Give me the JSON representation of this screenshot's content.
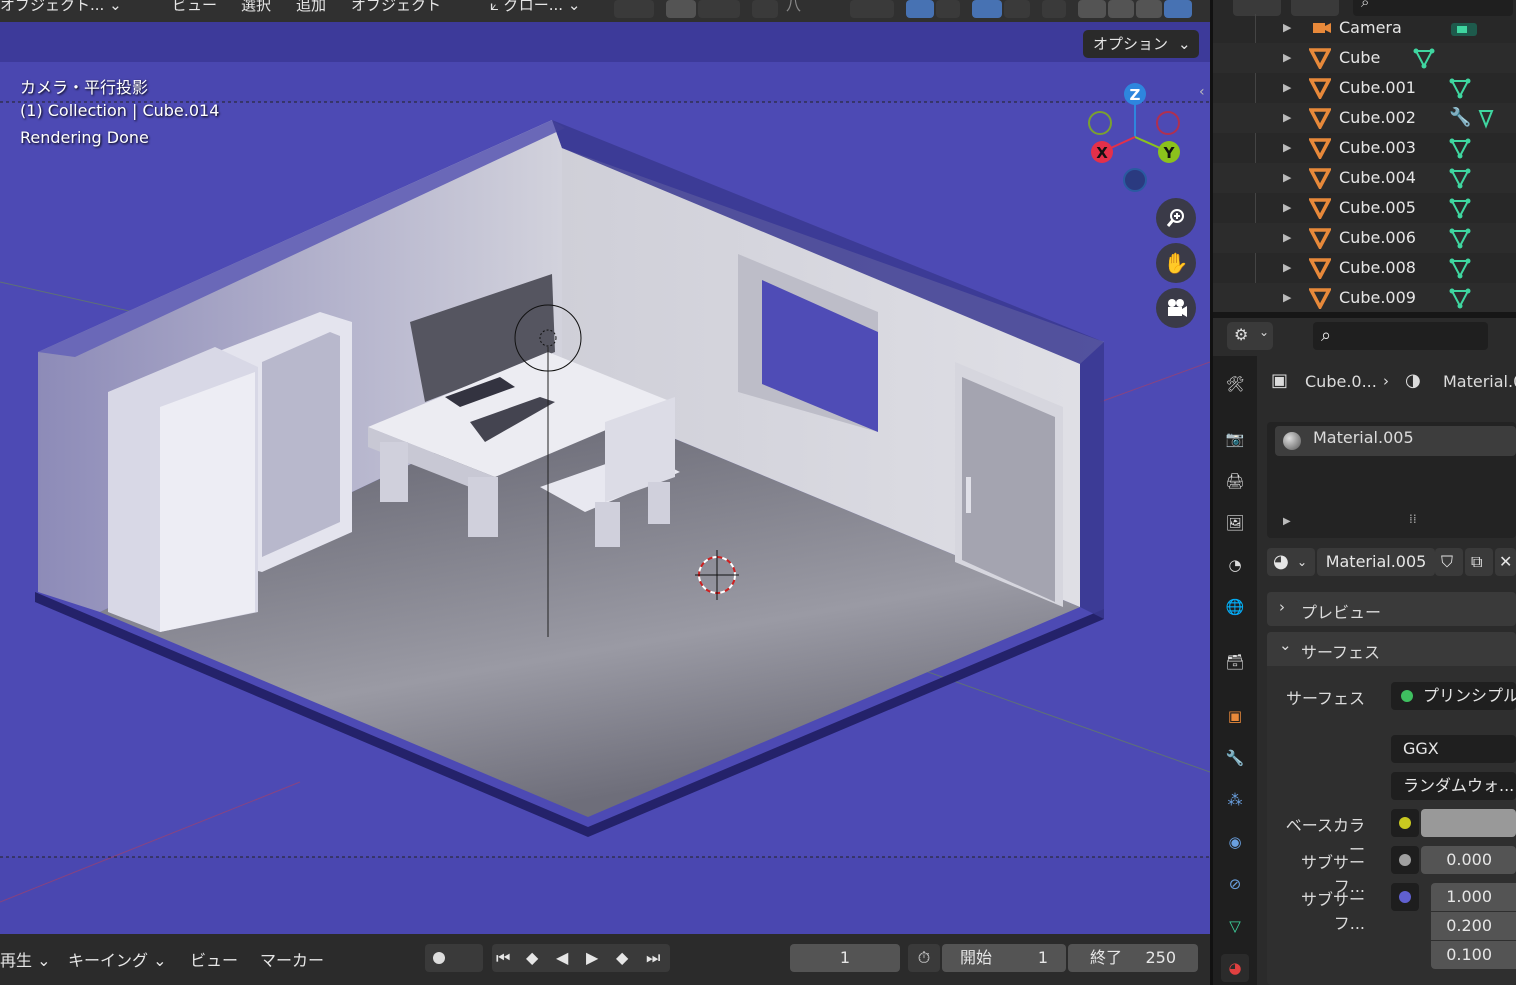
{
  "header": {
    "mode_label": "オブジェクト...",
    "menus": [
      "ビュー",
      "選択",
      "追加",
      "オブジェクト"
    ],
    "transform_orientation": "グロー...",
    "snap_label": "八",
    "options_label": "オプション"
  },
  "viewport": {
    "camera_label": "カメラ・平行投影",
    "collection_label": "(1) Collection | Cube.014",
    "status_label": "Rendering Done",
    "gizmo": {
      "z": "Z",
      "y": "Y",
      "x": "X"
    },
    "background_color": "#4a47b0"
  },
  "timeline": {
    "playback_label": "再生",
    "keying_label": "キーイング",
    "view_label": "ビュー",
    "marker_label": "マーカー",
    "current_frame": "1",
    "start_label": "開始",
    "start_value": "1",
    "end_label": "終了",
    "end_value": "250"
  },
  "outliner": {
    "rows": [
      {
        "name": "Camera",
        "icon": "camera-data-icon"
      },
      {
        "name": "Cube",
        "icon": "mesh-data-icon"
      },
      {
        "name": "Cube.001",
        "icon": "mesh-data-icon"
      },
      {
        "name": "Cube.002",
        "icon": "modifier-wrench-icon"
      },
      {
        "name": "Cube.003",
        "icon": "mesh-data-icon"
      },
      {
        "name": "Cube.004",
        "icon": "mesh-data-icon"
      },
      {
        "name": "Cube.005",
        "icon": "mesh-data-icon"
      },
      {
        "name": "Cube.006",
        "icon": "mesh-data-icon"
      },
      {
        "name": "Cube.008",
        "icon": "mesh-data-icon"
      },
      {
        "name": "Cube.009",
        "icon": "mesh-data-icon"
      }
    ]
  },
  "properties": {
    "breadcrumb_object": "Cube.0...",
    "breadcrumb_material": "Material.0",
    "slot_material": "Material.005",
    "material_name": "Material.005",
    "preview_label": "プレビュー",
    "surface_panel_label": "サーフェス",
    "surface_label": "サーフェス",
    "surface_value": "プリンシプル",
    "distribution_value": "GGX",
    "subsurface_method_value": "ランダムウォ...",
    "base_color_label": "ベースカラー",
    "subsurface_label": "サブサーフ...",
    "subsurface_value": "0.000",
    "subsurface_radius_label": "サブサーフ...",
    "radius_values": [
      "1.000",
      "0.200",
      "0.100"
    ]
  },
  "colors": {
    "accent_blue": "#4772b3",
    "mesh_green": "#3fd6a0",
    "object_orange": "#e8893a",
    "gizmo_x": "#e4304a",
    "gizmo_y": "#8bc21c",
    "gizmo_z": "#2e86de"
  }
}
